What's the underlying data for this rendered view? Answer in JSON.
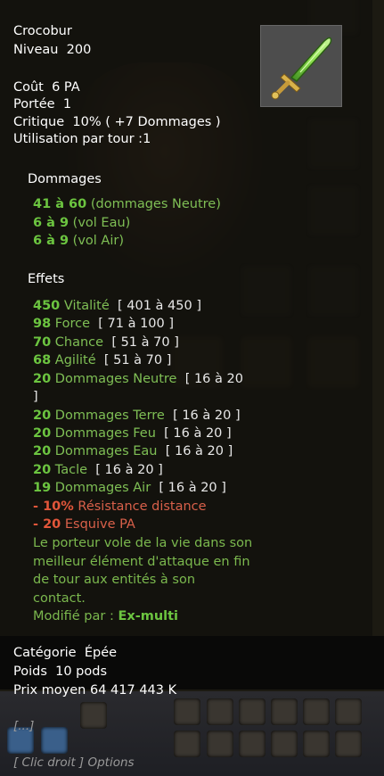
{
  "item": {
    "name": "Crocobur",
    "level_label": "Niveau",
    "level": "200",
    "weapon_icon": "green-sword-icon",
    "cost_label": "Coût",
    "cost": "6 PA",
    "range_label": "Portée",
    "range": "1",
    "crit_label": "Critique",
    "crit": "10% ( +7 Dommages )",
    "use_label": "Utilisation par tour :1"
  },
  "damages": {
    "title": "Dommages",
    "lines": [
      {
        "value": "41 à 60",
        "label": "(dommages Neutre)"
      },
      {
        "value": "6 à 9",
        "label": "(vol Eau)"
      },
      {
        "value": "6 à 9",
        "label": "(vol Air)"
      }
    ]
  },
  "effects": {
    "title": "Effets",
    "lines": [
      {
        "value": "450",
        "label": "Vitalité",
        "range": "[ 401 à 450 ]"
      },
      {
        "value": "98",
        "label": "Force",
        "range": "[ 71 à 100 ]"
      },
      {
        "value": "70",
        "label": "Chance",
        "range": "[ 51 à 70 ]"
      },
      {
        "value": "68",
        "label": "Agilité",
        "range": "[ 51 à 70 ]"
      },
      {
        "value": "20",
        "label": "Dommages Neutre",
        "range": "[ 16 à 20"
      },
      {
        "value": "20",
        "label": "Dommages Terre",
        "range": "[ 16 à 20 ]"
      },
      {
        "value": "20",
        "label": "Dommages Feu",
        "range": "[ 16 à 20 ]"
      },
      {
        "value": "20",
        "label": "Dommages Eau",
        "range": "[ 16 à 20 ]"
      },
      {
        "value": "20",
        "label": "Tacle",
        "range": "[ 16 à 20 ]"
      },
      {
        "value": "19",
        "label": "Dommages Air",
        "range": "[ 16 à 20 ]"
      }
    ],
    "wrap_bracket": "]",
    "malus": [
      {
        "value": "- 10%",
        "label": "Résistance distance"
      },
      {
        "value": "- 20",
        "label": "Esquive PA"
      }
    ],
    "description": [
      "Le porteur vole de la vie dans son",
      "meilleur élément d'attaque en fin",
      "de tour aux entités à son",
      "contact."
    ],
    "modified_label": "Modifié par :",
    "modified_by": "Ex-multi"
  },
  "info": {
    "category_label": "Catégorie",
    "category": "Épée",
    "weight_label": "Poids",
    "weight": "10 pods",
    "price_label": "Prix moyen",
    "price": "64 417 443 K"
  },
  "footer": {
    "ellipsis": "[...]",
    "options": "[ Clic droit ] Options"
  },
  "colors": {
    "bonus_green": "#6cc540",
    "malus_red": "#e2563a",
    "text_white": "#ffffff"
  }
}
